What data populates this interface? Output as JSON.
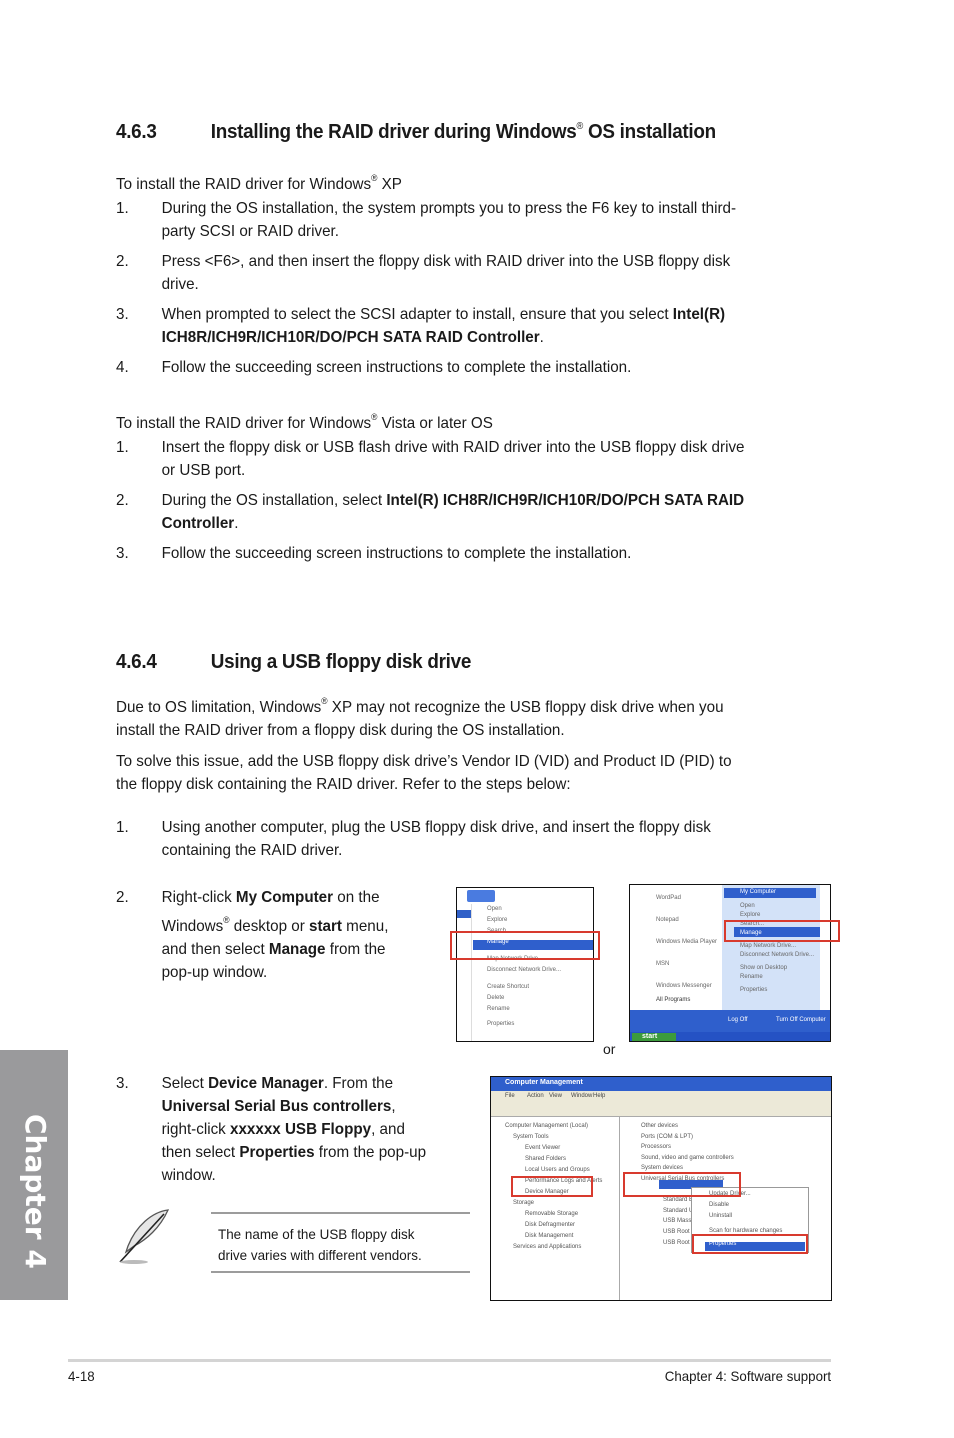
{
  "section_463": {
    "number": "4.6.3",
    "title_pre": "Installing the RAID driver during Windows",
    "title_reg": "®",
    "title_post": " OS installation",
    "xp_intro_pre": "To install the RAID driver for Windows",
    "xp_intro_reg": "®",
    "xp_intro_post": " XP",
    "xp_steps": [
      {
        "n": "1.",
        "line1": "During the OS installation, the system prompts you to press the F6 key to install third-",
        "line2": "party SCSI or RAID driver."
      },
      {
        "n": "2.",
        "line1": "Press <F6>, and then insert the floppy disk with RAID driver into the USB floppy disk",
        "line2": "drive."
      },
      {
        "n": "3.",
        "line1_pre": "When prompted to select the SCSI adapter to install, ensure that you select ",
        "line1_bold": "Intel(R)",
        "line2_bold": "ICH8R/ICH9R/ICH10R/DO/PCH SATA RAID Controller",
        "line2_post": "."
      },
      {
        "n": "4.",
        "line1": "Follow the succeeding screen instructions to complete the installation."
      }
    ],
    "vista_intro_pre": "To install the RAID driver for Windows",
    "vista_intro_reg": "®",
    "vista_intro_post": " Vista or later OS",
    "vista_steps": [
      {
        "n": "1.",
        "line1": "Insert the floppy disk or USB flash drive with RAID driver into the USB floppy disk drive",
        "line2": "or USB port."
      },
      {
        "n": "2.",
        "line1_pre": "During the OS installation, select ",
        "line1_bold": "Intel(R) ICH8R/ICH9R/ICH10R/DO/PCH SATA RAID",
        "line2_bold": "Controller",
        "line2_post": "."
      },
      {
        "n": "3.",
        "line1": "Follow the succeeding screen instructions to complete the installation."
      }
    ]
  },
  "section_464": {
    "number": "4.6.4",
    "title": "Using a USB floppy disk drive",
    "para1_pre": "Due to OS limitation, Windows",
    "para1_reg": "®",
    "para1_post": " XP may not recognize the USB floppy disk drive when you",
    "para1_line2": "install the RAID driver from a floppy disk during the OS installation.",
    "para2_line1": "To solve this issue, add the USB floppy disk drive’s Vendor ID (VID) and Product ID (PID) to",
    "para2_line2": "the floppy disk containing the RAID driver. Refer to the steps below:",
    "step1": {
      "n": "1.",
      "line1": "Using another computer, plug the USB floppy disk drive, and insert the floppy disk",
      "line2": "containing the RAID driver."
    },
    "step2": {
      "n": "2.",
      "l1_pre": "Right-click ",
      "l1_bold": "My Computer",
      "l1_post": " on the",
      "l2_pre": "Windows",
      "l2_reg": "®",
      "l2_mid": " desktop or ",
      "l2_bold": "start",
      "l2_post": " menu,",
      "l3_pre": "and then select ",
      "l3_bold": "Manage",
      "l3_post": " from the",
      "l4": "pop-up window."
    },
    "or_label": "or",
    "step3": {
      "n": "3.",
      "l1_pre": "Select ",
      "l1_bold": "Device Manager",
      "l1_post": ". From the",
      "l2_bold": "Universal Serial Bus controllers",
      "l2_post": ",",
      "l3_pre": "right-click ",
      "l3_bold": "xxxxxx USB Floppy",
      "l3_post": ", and",
      "l4_pre": "then select ",
      "l4_bold": "Properties",
      "l4_post": " from the pop-up",
      "l5": "window."
    },
    "note": {
      "line1": "The name of the USB floppy disk",
      "line2": "drive varies with different vendors."
    },
    "screenshot_context_menu": {
      "items": [
        "Open",
        "Explore",
        "Search...",
        "Manage",
        "Map Network Drive...",
        "Disconnect Network Drive...",
        "Create Shortcut",
        "Delete",
        "Rename",
        "Properties"
      ],
      "highlighted": "Manage"
    },
    "screenshot_start_menu": {
      "left_items": [
        "WordPad",
        "Notepad",
        "Windows Media Player",
        "MSN",
        "Windows Messenger"
      ],
      "all_programs": "All Programs",
      "start_label": "start",
      "my_computer": "My Computer",
      "menu_items": [
        "Open",
        "Explore",
        "Search...",
        "Manage",
        "Map Network Drive...",
        "Disconnect Network Drive...",
        "Show on Desktop",
        "Rename",
        "Properties"
      ],
      "highlighted": "Manage",
      "logoff": "Log Off",
      "turnoff": "Turn Off Computer"
    },
    "screenshot_computer_management": {
      "title": "Computer Management",
      "menu": [
        "File",
        "Action",
        "View",
        "Window",
        "Help"
      ],
      "tree": [
        "Computer Management (Local)",
        "System Tools",
        "Event Viewer",
        "Shared Folders",
        "Local Users and Groups",
        "Performance Logs and Alerts",
        "Device Manager",
        "Storage",
        "Removable Storage",
        "Disk Defragmenter",
        "Disk Management",
        "Services and Applications"
      ],
      "devices": [
        "Other devices",
        "Ports (COM & LPT)",
        "Processors",
        "Sound, video and game controllers",
        "System devices",
        "Universal Serial Bus controllers",
        "xxxxxx USB Floppy",
        "Standard Enhanced PCI to USB Host Controller",
        "Standard Universal PCI to USB Host Controller",
        "USB Mass Storage Device",
        "USB Root Hub",
        "USB Root Hub"
      ],
      "context": [
        "Update Driver...",
        "Disable",
        "Uninstall",
        "Scan for hardware changes",
        "Properties"
      ],
      "highlighted": "Properties"
    }
  },
  "chapter_tab": "Chapter 4",
  "footer": {
    "page_number": "4-18",
    "chapter_title": "Chapter 4: Software support"
  },
  "colors": {
    "highlight_box": "#d83a2e",
    "chapter_tab": "#9a9a9c",
    "xp_blue": "#2f5fcc"
  }
}
